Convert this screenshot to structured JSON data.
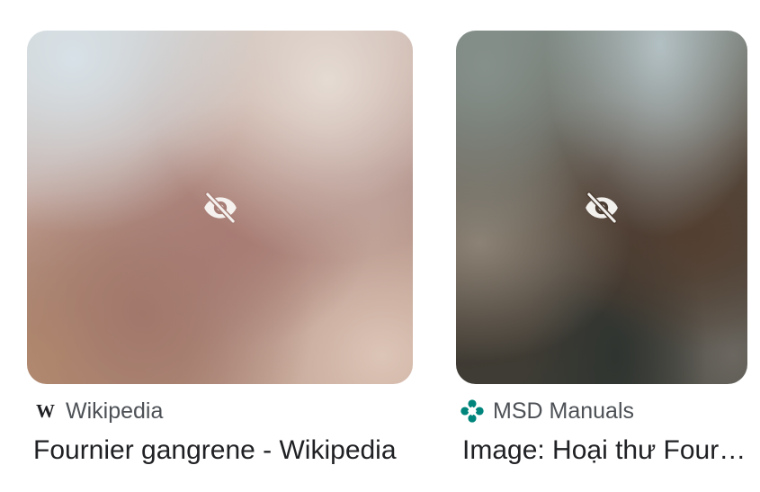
{
  "results": [
    {
      "source_name": "Wikipedia",
      "favicon_icon": "wikipedia-w-icon",
      "favicon_glyph": "W",
      "title": "Fournier gangrene - Wikipedia",
      "overlay_icon": "eye-off-icon",
      "thumbnail_blurred": true
    },
    {
      "source_name": "MSD Manuals",
      "favicon_icon": "msd-manuals-logo-icon",
      "favicon_color": "#00857c",
      "title": "Image: Hoại thư Fournier",
      "overlay_icon": "eye-off-icon",
      "thumbnail_blurred": true
    }
  ]
}
